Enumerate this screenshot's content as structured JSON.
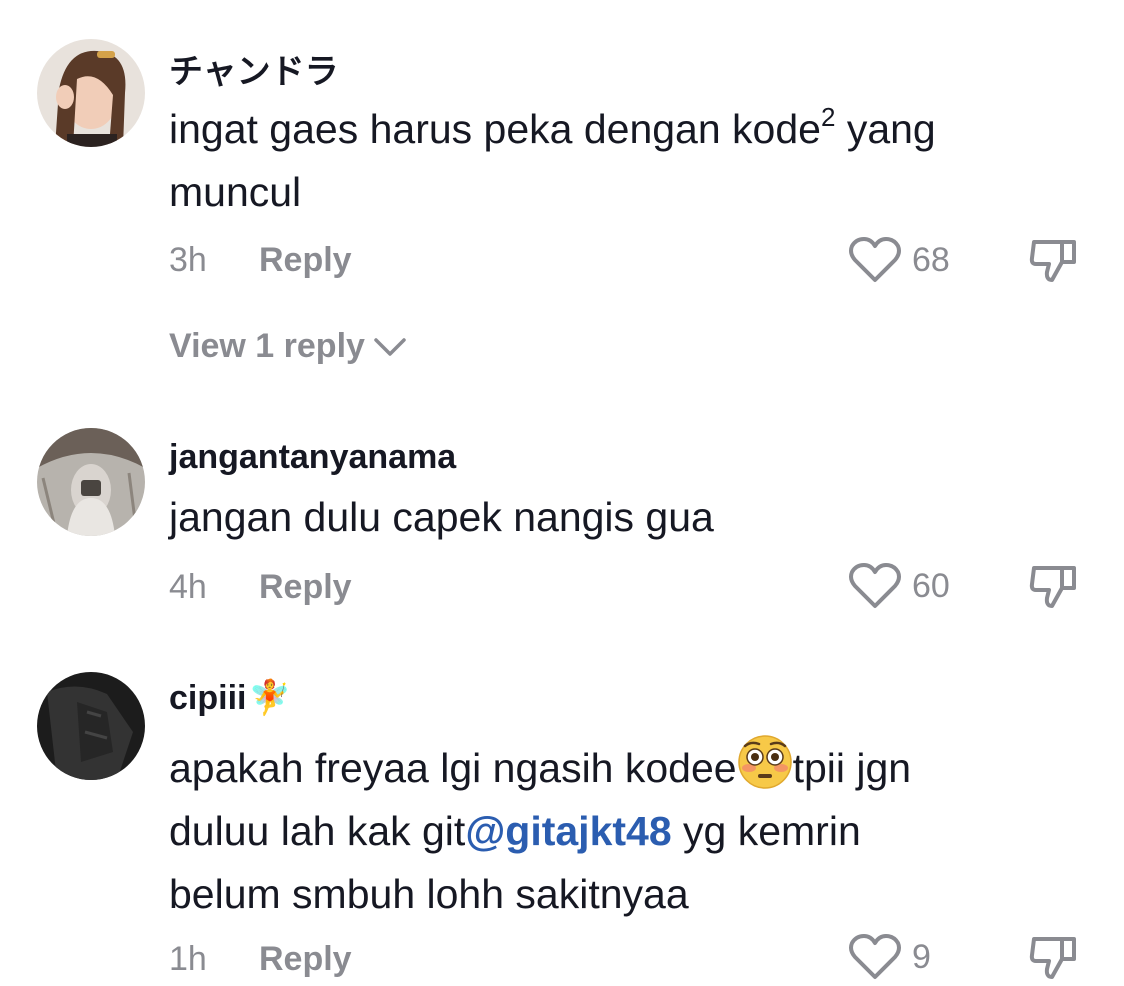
{
  "comments": [
    {
      "username": "チャンドラ",
      "text_parts": [
        "ingat gaes harus peka dengan kode",
        "2",
        " yang",
        "muncul"
      ],
      "time": "3h",
      "reply_label": "Reply",
      "likes": "68",
      "view_replies": "View 1 reply"
    },
    {
      "username": "jangantanyanama",
      "text": "jangan dulu capek nangis gua",
      "time": "4h",
      "reply_label": "Reply",
      "likes": "60"
    },
    {
      "username": "cipiii",
      "username_emoji": "🧚",
      "line1_before": "apakah freyaa lgi ngasih kodee",
      "line1_emoji": "flushed-face-emoji",
      "line1_after": "tpii jgn",
      "line2_before": "duluu lah kak git",
      "mention": "@gitajkt48",
      "line2_after": " yg kemrin",
      "line3": "belum smbuh lohh sakitnyaa",
      "time": "1h",
      "reply_label": "Reply",
      "likes": "9"
    }
  ],
  "icons": {
    "like": "heart-icon",
    "dislike": "thumbs-down-icon",
    "expand": "chevron-down-icon"
  },
  "colors": {
    "text": "#161823",
    "secondary": "#8a8b91",
    "mention": "#2b5db0"
  }
}
